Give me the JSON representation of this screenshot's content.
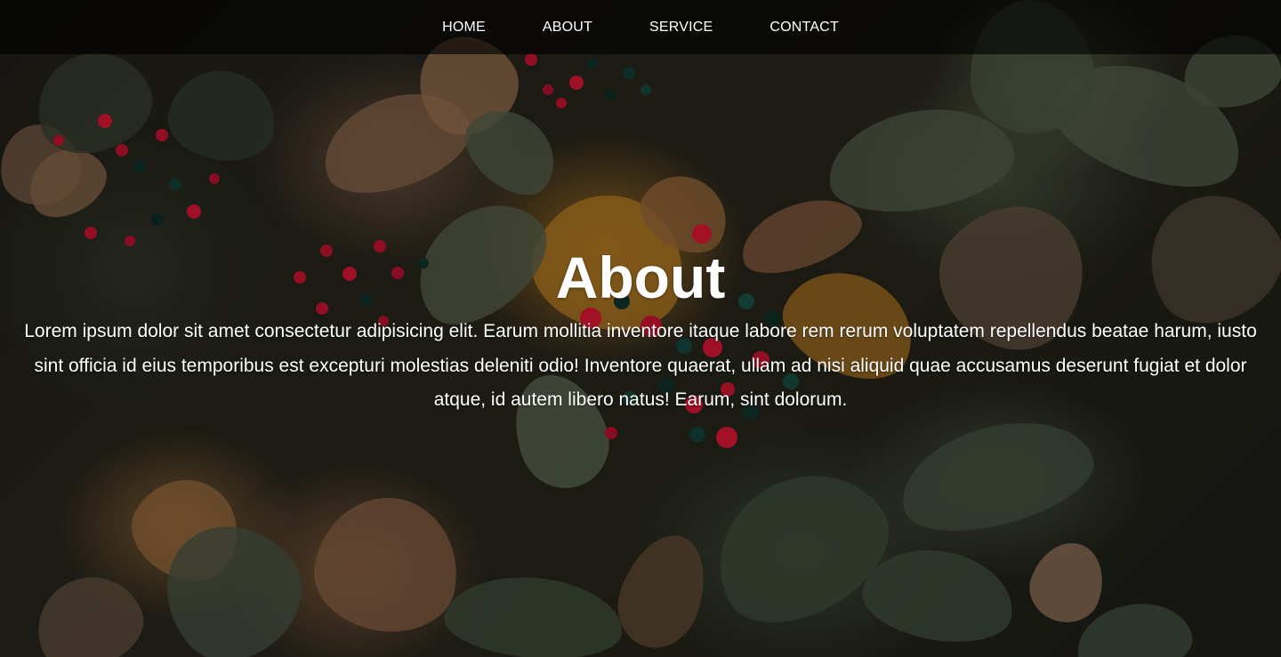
{
  "nav": {
    "items": [
      {
        "label": "HOME"
      },
      {
        "label": "ABOUT"
      },
      {
        "label": "SERVICE"
      },
      {
        "label": "CONTACT"
      }
    ]
  },
  "hero": {
    "title": "About",
    "paragraph": "Lorem ipsum dolor sit amet consectetur adipisicing elit. Earum mollitia inventore itaque labore rem rerum voluptatem repellendus beatae harum, iusto sint officia id eius temporibus est excepturi molestias deleniti odio! Inventore quaerat, ullam ad nisi aliquid quae accusamus deserunt fugiat et dolor atque, id autem libero natus! Earum, sint dolorum."
  },
  "colors": {
    "nav_background": "#000000",
    "text": "#ffffff",
    "berry_red": "#b0102a",
    "berry_dark": "#0c2a26",
    "leaf_green": "#3e4a3a",
    "leaf_orange": "#a06a20"
  }
}
